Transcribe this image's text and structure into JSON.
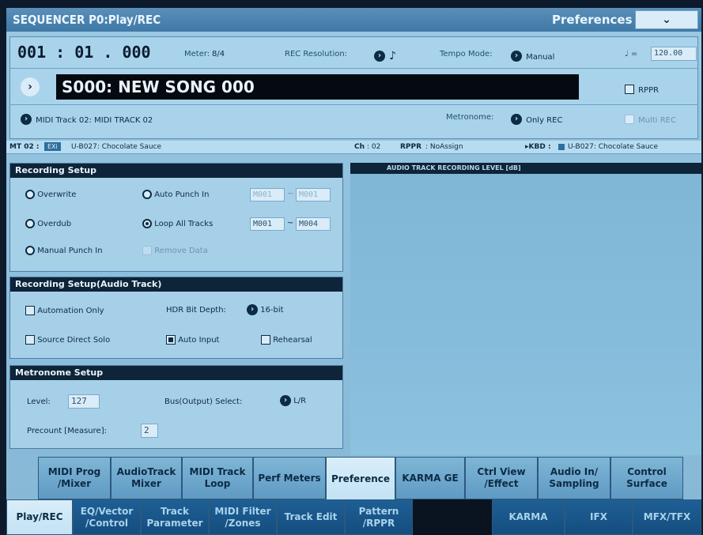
{
  "header": {
    "title": "SEQUENCER P0:Play/REC",
    "preferences_label": "Preferences",
    "dropdown_glyph": "⌄"
  },
  "transport": {
    "location": "001 : 01 . 000",
    "meter_label": "Meter:",
    "meter_value": "8/4",
    "rec_resolution_label": "REC Resolution:",
    "rec_resolution_value": "♪",
    "tempo_mode_label": "Tempo Mode:",
    "tempo_mode_value": "Manual",
    "tempo_label": "♩ =",
    "tempo_value": "120.00"
  },
  "song": {
    "name": "S000: NEW SONG 000",
    "rppr_label": "RPPR",
    "rppr_checked": false
  },
  "track": {
    "name": "MIDI Track 02: MIDI TRACK 02",
    "metronome_label": "Metronome:",
    "metronome_value": "Only REC",
    "multi_rec_label": "Multi REC"
  },
  "status": {
    "mt": "MT 02 :",
    "bank": "EXi",
    "program": "U-B027: Chocolate Sauce",
    "ch_label": "Ch",
    "ch_value": ": 02",
    "rppr_label": "RPPR",
    "rppr_value": ": NoAssign",
    "kbd_label": "▸KBD :",
    "kbd_program": "U-B027: Chocolate Sauce"
  },
  "recording_setup": {
    "title": "Recording Setup",
    "overwrite": "Overwrite",
    "overdub": "Overdub",
    "manual_punch": "Manual Punch In",
    "auto_punch": "Auto Punch In",
    "loop_all": "Loop All Tracks",
    "remove_data": "Remove Data",
    "punch_from": "M001",
    "punch_to": "M001",
    "loop_from": "M001",
    "loop_to": "M004",
    "range_sep": "~",
    "selected": "Loop All Tracks"
  },
  "audio_setup": {
    "title": "Recording Setup(Audio Track)",
    "automation_only": "Automation Only",
    "source_direct_solo": "Source Direct Solo",
    "hdr_bit_depth_label": "HDR Bit Depth:",
    "hdr_bit_depth_value": "16-bit",
    "auto_input": "Auto Input",
    "rehearsal": "Rehearsal",
    "auto_input_checked": true
  },
  "metronome_setup": {
    "title": "Metronome Setup",
    "level_label": "Level:",
    "level_value": "127",
    "bus_label": "Bus(Output) Select:",
    "bus_value": "L/R",
    "precount_label": "Precount [Measure]:",
    "precount_value": "2"
  },
  "audio_meter": {
    "title": "AUDIO TRACK RECORDING LEVEL [dB]"
  },
  "upper_tabs": [
    "MIDI Prog /Mixer",
    "AudioTrack Mixer",
    "MIDI Track Loop",
    "Perf Meters",
    "Preference",
    "KARMA GE",
    "Ctrl View /Effect",
    "Audio In/ Sampling",
    "Control Surface"
  ],
  "lower_tabs": [
    "Play/REC",
    "EQ/Vector /Control",
    "Track Parameter",
    "MIDI Filter /Zones",
    "Track Edit",
    "Pattern /RPPR",
    "",
    "KARMA",
    "IFX",
    "MFX/TFX"
  ],
  "colors": {
    "screen_bg": "#8fc0dd",
    "header_dark": "#0e2438",
    "tab_active": "#c2e2f4",
    "tab_dark": "#154d7f"
  }
}
